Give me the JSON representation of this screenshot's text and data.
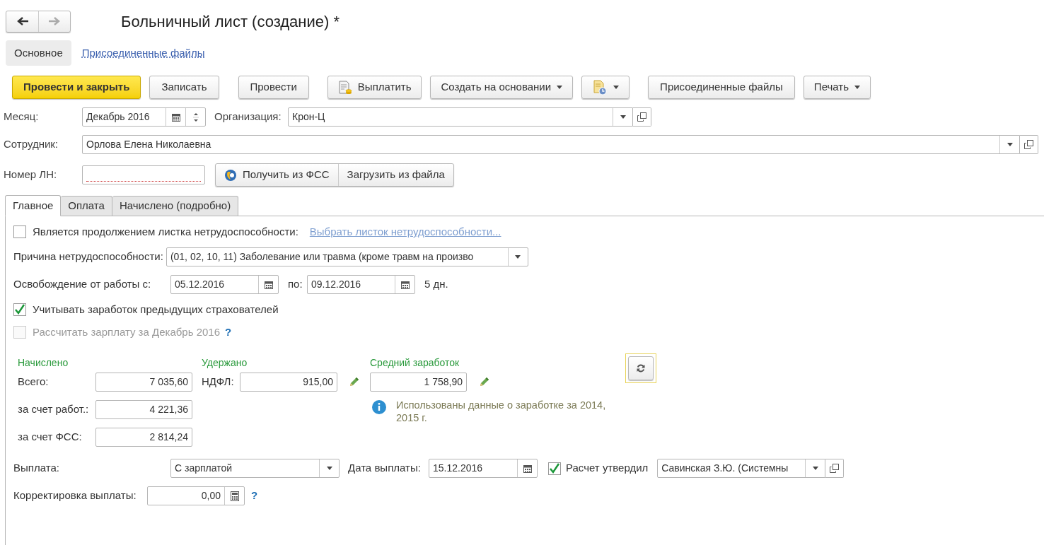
{
  "window": {
    "title": "Больничный лист (создание) *"
  },
  "nav": [
    {
      "kind": "back",
      "disabled": false
    },
    {
      "kind": "forward",
      "disabled": true
    }
  ],
  "sections": [
    {
      "label": "Основное",
      "selected": true
    },
    {
      "label": "Присоединенные файлы",
      "selected": false
    }
  ],
  "toolbar": [
    {
      "kind": "primary",
      "label": "Провести и закрыть"
    },
    {
      "kind": "plain",
      "label": "Записать"
    },
    {
      "kind": "plain",
      "label": "Провести"
    },
    {
      "kind": "icon_label",
      "label": "Выплатить"
    },
    {
      "kind": "dropdown",
      "label": "Создать на основании"
    },
    {
      "kind": "icon_dropdown"
    },
    {
      "kind": "plain",
      "label": "Присоединенные файлы"
    },
    {
      "kind": "dropdown",
      "label": "Печать"
    }
  ],
  "month": {
    "label": "Месяц:",
    "value": "Декабрь 2016"
  },
  "organization": {
    "label": "Организация:",
    "value": "Крон-Ц"
  },
  "employee": {
    "label": "Сотрудник:",
    "value": "Орлова Елена Николаевна"
  },
  "sick_note_number": {
    "label": "Номер ЛН:",
    "required": true,
    "buttons": [
      "Получить из ФСС",
      "Загрузить из файла"
    ]
  },
  "tabs": [
    {
      "label": "Главное",
      "selected": true
    },
    {
      "label": "Оплата",
      "selected": false
    },
    {
      "label": "Начислено (подробно)",
      "selected": false
    }
  ],
  "continuation": {
    "label": "Является продолжением листка нетрудоспособности:",
    "checked": false,
    "link": "Выбрать листок нетрудоспособности..."
  },
  "reason": {
    "label": "Причина нетрудоспособности:",
    "value": "(01, 02, 10, 11) Заболевание или травма (кроме травм на произво"
  },
  "release": {
    "label": "Освобождение от работы с:",
    "from": "05.12.2016",
    "to_label": "по:",
    "to": "09.12.2016",
    "days": "5 дн."
  },
  "options": [
    {
      "label": "Учитывать заработок предыдущих страхователей",
      "checked": true,
      "disabled": false
    },
    {
      "label": "Рассчитать зарплату за Декабрь 2016",
      "checked": false,
      "disabled": true,
      "help": "?"
    }
  ],
  "accrued": {
    "heading": "Начислено",
    "rows": [
      {
        "label": "Всего:",
        "value": "7 035,60"
      },
      {
        "label": "за счет работ.:",
        "value": "4 221,36"
      },
      {
        "label": "за счет ФСС:",
        "value": "2 814,24"
      }
    ]
  },
  "withheld": {
    "heading": "Удержано",
    "label": "НДФЛ:",
    "value": "915,00"
  },
  "average": {
    "heading": "Средний заработок",
    "value": "1 758,90",
    "info": "Использованы данные о заработке за 2014,  2015 г."
  },
  "payment": {
    "label": "Выплата:",
    "value": "С зарплатой",
    "date_label": "Дата выплаты:",
    "date": "15.12.2016",
    "approved": {
      "label": "Расчет утвердил",
      "checked": true
    },
    "approver": "Савинская З.Ю. (Системны"
  },
  "correction": {
    "label": "Корректировка выплаты:",
    "value": "0,00",
    "help": "?"
  }
}
